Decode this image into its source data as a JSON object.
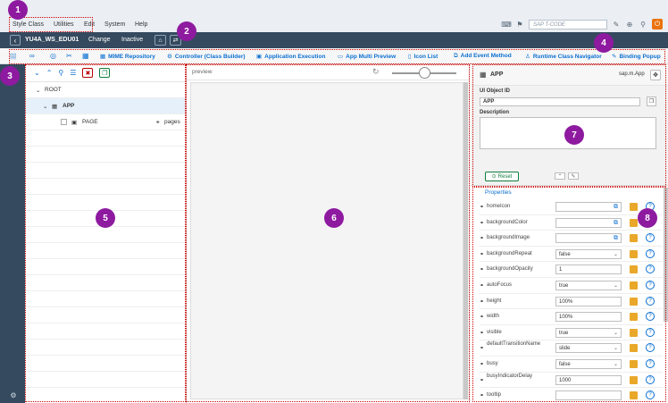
{
  "menubar": {
    "items": [
      "Style Class",
      "Utilities",
      "Edit",
      "System",
      "Help"
    ],
    "tcode_placeholder": "SAP T-CODE"
  },
  "title": {
    "name": "YU4A_WS_EDU01",
    "mode": "Change",
    "status": "Inactive"
  },
  "toolbar": {
    "buttons": [
      "MIME Repository",
      "Controller (Class Builder)",
      "Application Execution",
      "App Multi Preview",
      "Icon List",
      "Add Event Method",
      "Runtime Class Navigator",
      "Binding Popup"
    ]
  },
  "tree": {
    "root": "ROOT",
    "app": "APP",
    "page": "PAGE",
    "page_aggregation": "pages"
  },
  "preview": {
    "label": "preview"
  },
  "attributes": {
    "object_name": "APP",
    "object_class": "sap.m.App",
    "ui_object_id_label": "UI Object ID",
    "ui_object_id": "APP",
    "description_label": "Description",
    "reset_label": "Reset",
    "properties_title": "Properties",
    "properties": [
      {
        "name": "homeIcon",
        "value": "",
        "kind": "valuehelp"
      },
      {
        "name": "backgroundColor",
        "value": "",
        "kind": "valuehelp"
      },
      {
        "name": "backgroundImage",
        "value": "",
        "kind": "valuehelp"
      },
      {
        "name": "backgroundRepeat",
        "value": "false",
        "kind": "dropdown"
      },
      {
        "name": "backgroundOpacity",
        "value": "1",
        "kind": "input"
      },
      {
        "name": "autoFocus",
        "value": "true",
        "kind": "dropdown"
      },
      {
        "name": "height",
        "value": "100%",
        "kind": "input"
      },
      {
        "name": "width",
        "value": "100%",
        "kind": "input"
      },
      {
        "name": "visible",
        "value": "true",
        "kind": "dropdown"
      },
      {
        "name": "defaultTransitionName",
        "value": "slide",
        "kind": "dropdown"
      },
      {
        "name": "busy",
        "value": "false",
        "kind": "dropdown"
      },
      {
        "name": "busyIndicatorDelay",
        "value": "1000",
        "kind": "input"
      },
      {
        "name": "tooltip",
        "value": "",
        "kind": "input"
      }
    ]
  },
  "markers": [
    "1",
    "2",
    "3",
    "4",
    "5",
    "6",
    "7",
    "8"
  ]
}
